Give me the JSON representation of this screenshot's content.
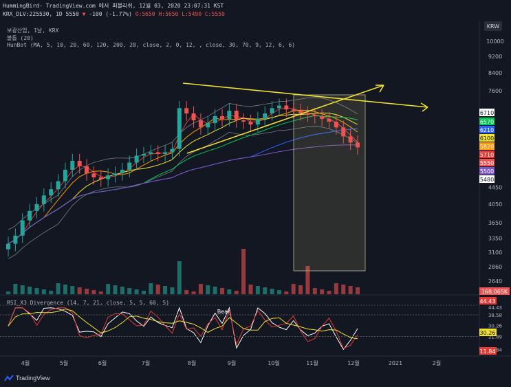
{
  "header": {
    "line1": "HummingBird- TradingView.com 에서 퍼블리쉬, 12월 03, 2020 23:07:31 KST",
    "symbol": "KRX_DLV:225530, 1D 5550",
    "change": "-100 (-1.77%)",
    "ohlc": "O:5650 H:5650 L:5490 C:5550"
  },
  "indicators": {
    "name": "보광산업, 1날, KRX",
    "bollinger": "볼톱 (20)",
    "hunbot": "HunBot (MA, 5, 10, 20, 60, 120, 200, 20, close, 2, 0, 12, , close, 30, 70, 9, 12, 6, 6)"
  },
  "rsi_label": "RSI_X3 Divergence (14, 7, 21, close, 5, 5, 60, 5)",
  "bear_label": "Bear",
  "currency": "KRW",
  "branding": "TradingView",
  "colors": {
    "up": "#26a69a",
    "down": "#ef5350",
    "trend": "#f0e030",
    "bg": "#131722"
  },
  "chart_data": [
    {
      "type": "candlestick",
      "title": "",
      "y_scale": "log",
      "y_ticks": [
        "10000",
        "9200",
        "8400",
        "7600",
        "4450",
        "4050",
        "3650",
        "3350",
        "3100",
        "2860",
        "2640"
      ],
      "x_ticks": [
        "4월",
        "5월",
        "6월",
        "7월",
        "8월",
        "9월",
        "10월",
        "11월",
        "12월",
        "2021",
        "2월"
      ],
      "price_labels": [
        {
          "value": "6710",
          "color": "#ffffff"
        },
        {
          "value": "6570",
          "color": "#00c853"
        },
        {
          "value": "6210",
          "color": "#2962ff"
        },
        {
          "value": "6100",
          "color": "#f0e030"
        },
        {
          "value": "5820",
          "color": "#ff9800"
        },
        {
          "value": "5710",
          "color": "#e53935"
        },
        {
          "value": "5550",
          "color": "#ef5350"
        },
        {
          "value": "5500",
          "color": "#7e57c2"
        },
        {
          "value": "5480",
          "color": "#ffffff"
        },
        {
          "value": "168.065K",
          "color": "#ef5350"
        }
      ],
      "close_approx": [
        3250,
        3400,
        3700,
        3900,
        4050,
        4250,
        4400,
        4600,
        4900,
        5150,
        5000,
        4800,
        4700,
        4650,
        4750,
        4800,
        4900,
        5100,
        5300,
        5350,
        5400,
        5350,
        5400,
        5500,
        6900,
        6700,
        6450,
        6200,
        6350,
        6600,
        6500,
        6800,
        6450,
        6400,
        6300,
        6500,
        6700,
        6900,
        7000,
        6850,
        6800,
        6700,
        6650,
        6600,
        6500,
        6400,
        6200,
        5900,
        5700,
        5550
      ]
    },
    {
      "type": "line",
      "title": "",
      "y_ticks": [
        "44.43",
        "38.58",
        "30.26",
        "21.89",
        "11.84"
      ],
      "rsi_labels": [
        {
          "value": "44.43",
          "color": "#e53935"
        },
        {
          "value": "38.58",
          "color": "#ffffff"
        },
        {
          "value": "30.26",
          "color": "#f0e030"
        },
        {
          "value": "21.89",
          "color": "#ffffff"
        },
        {
          "value": "11.84",
          "color": "#e53935"
        }
      ]
    }
  ]
}
